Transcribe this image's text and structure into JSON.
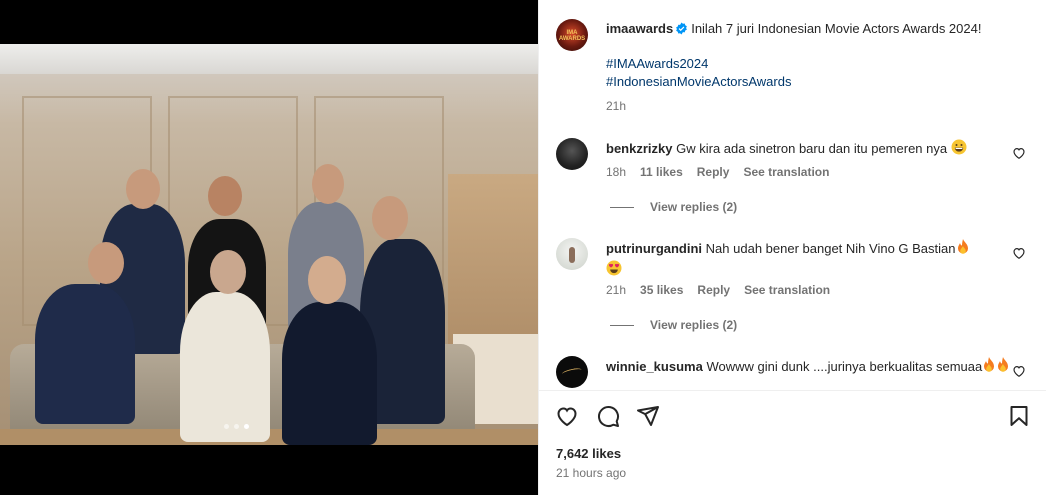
{
  "post": {
    "author": "imaawards",
    "caption": "Inilah 7 juri Indonesian Movie Actors Awards 2024!",
    "hashtags": [
      "#IMAAwards2024",
      "#IndonesianMovieActorsAwards"
    ],
    "time": "21h",
    "avatar_text": "IMA AWARDS"
  },
  "comments": [
    {
      "user": "benkzrizky",
      "text": "Gw kira ada sinetron baru dan itu pemeren nya",
      "emoji": "grinning-face",
      "time": "18h",
      "likes": "11 likes",
      "reply": "Reply",
      "translate": "See translation",
      "replies": "View replies (2)"
    },
    {
      "user": "putrinurgandini",
      "text": "Nah udah bener banget Nih Vino G Bastian",
      "emoji": "fire",
      "emoji2": "heart-eyes",
      "time": "21h",
      "likes": "35 likes",
      "reply": "Reply",
      "translate": "See translation",
      "replies": "View replies (2)"
    },
    {
      "user": "winnie_kusuma",
      "text": "Wowww gini dunk ....jurinya berkualitas semuaa",
      "emoji": "fire",
      "emoji2": "fire"
    }
  ],
  "footer": {
    "likes": "7,642 likes",
    "ago": "21 hours ago"
  },
  "carousel": {
    "count": 3,
    "active": 2
  },
  "colors": {
    "link": "#00376b",
    "muted": "#737373",
    "text": "#262626",
    "verified": "#0095f6"
  }
}
